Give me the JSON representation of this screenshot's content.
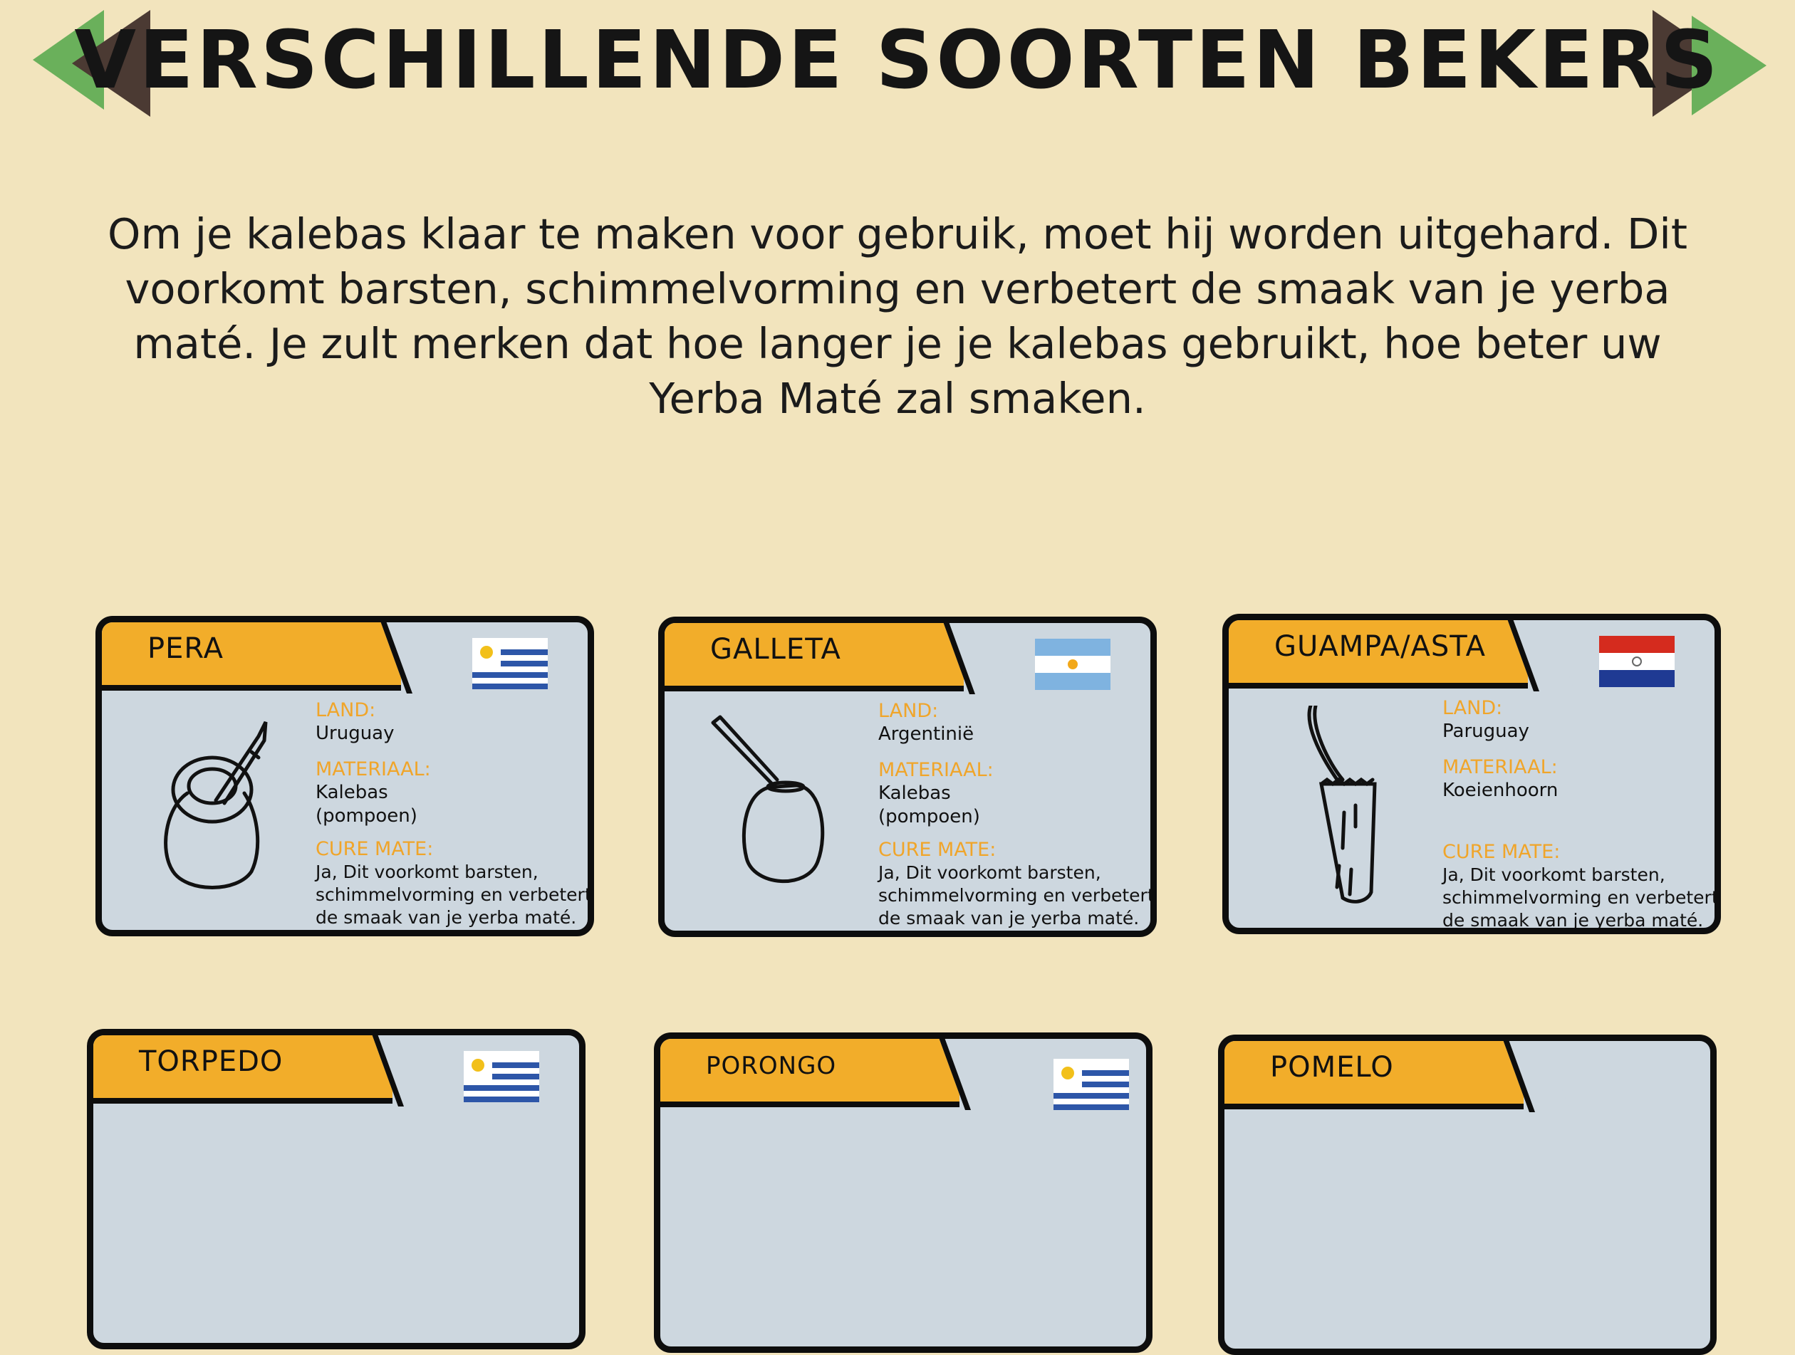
{
  "page": {
    "title": "VERSCHILLENDE SOORTEN BEKERS",
    "intro": "Om je kalebas klaar te maken voor gebruik, moet hij worden uitgehard. Dit voorkomt barsten, schimmelvorming en verbetert de smaak van je yerba maté. Je zult merken dat hoe langer je je kalebas gebruikt, hoe beter uw Yerba Maté zal smaken."
  },
  "nav": {
    "prev_icon": "prev-arrow-icon",
    "next_icon": "next-arrow-icon"
  },
  "colors": {
    "background": "#f2e4bd",
    "header": "#f2ad2a",
    "card": "#cdd7df",
    "label": "#f0a52a",
    "arrow_green": "#6ab05b",
    "arrow_brown": "#4b3a33"
  },
  "cards": [
    {
      "name": "PERA",
      "flag": "uruguay-flag-icon",
      "icon": "pera-cup-icon",
      "land_label": "LAND:",
      "land": "Uruguay",
      "material_label": "MATERIAAL:",
      "material": "Kalebas\n(pompoen)",
      "cure_label": "CURE MATE:",
      "cure": "Ja, Dit voorkomt barsten,\nschimmelvorming en verbetert\nde smaak van je yerba maté."
    },
    {
      "name": "GALLETA",
      "flag": "argentina-flag-icon",
      "icon": "galleta-cup-icon",
      "land_label": "LAND:",
      "land": "Argentinië",
      "material_label": "MATERIAAL:",
      "material": "Kalebas\n(pompoen)",
      "cure_label": "CURE MATE:",
      "cure": "Ja, Dit voorkomt barsten,\nschimmelvorming en verbetert\nde smaak van je yerba maté."
    },
    {
      "name": "GUAMPA/ASTA",
      "flag": "paraguay-flag-icon",
      "icon": "guampa-cup-icon",
      "land_label": "LAND:",
      "land": "Paruguay",
      "material_label": "MATERIAAL:",
      "material": "Koeienhoorn",
      "cure_label": "CURE MATE:",
      "cure": "Ja, Dit voorkomt barsten,\nschimmelvorming en verbetert\nde smaak van je yerba maté."
    },
    {
      "name": "TORPEDO",
      "flag": "uruguay-flag-icon"
    },
    {
      "name": "PORONGO",
      "flag": "uruguay-flag-icon"
    },
    {
      "name": "POMELO",
      "flag": ""
    }
  ]
}
